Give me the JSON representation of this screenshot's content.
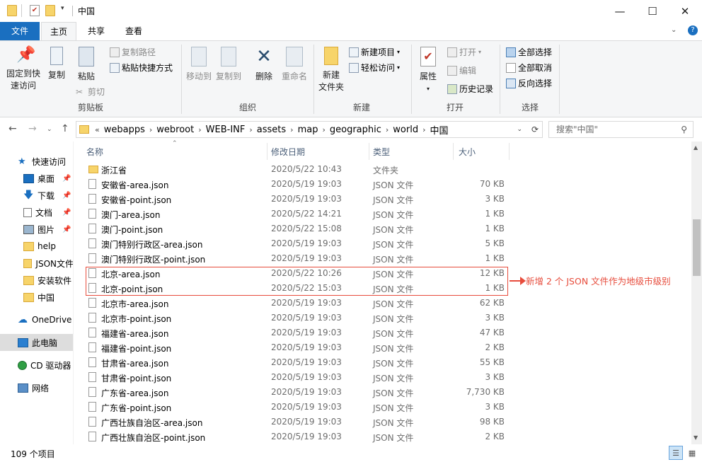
{
  "window": {
    "title": "中国"
  },
  "ribbon_tabs": {
    "file": "文件",
    "home": "主页",
    "share": "共享",
    "view": "查看"
  },
  "ribbon": {
    "clipboard": {
      "pin_label_1": "固定到快",
      "pin_label_2": "速访问",
      "copy": "复制",
      "paste": "粘贴",
      "copy_path": "复制路径",
      "paste_shortcut": "粘贴快捷方式",
      "cut": "剪切",
      "group": "剪贴板"
    },
    "organize": {
      "move_to": "移动到",
      "copy_to": "复制到",
      "delete": "删除",
      "rename": "重命名",
      "group": "组织"
    },
    "new": {
      "new_folder_1": "新建",
      "new_folder_2": "文件夹",
      "new_item": "新建项目",
      "easy_access": "轻松访问",
      "group": "新建"
    },
    "open": {
      "properties": "属性",
      "open": "打开",
      "edit": "编辑",
      "history": "历史记录",
      "group": "打开"
    },
    "select": {
      "select_all": "全部选择",
      "select_none": "全部取消",
      "invert": "反向选择",
      "group": "选择"
    }
  },
  "address": {
    "overflow": "«",
    "crumbs": [
      "webapps",
      "webroot",
      "WEB-INF",
      "assets",
      "map",
      "geographic",
      "world",
      "中国"
    ],
    "search_placeholder": "搜索\"中国\""
  },
  "nav_pane": {
    "items": [
      {
        "label": "快速访问",
        "icon": "star-icon"
      },
      {
        "label": "桌面",
        "icon": "desktop-icon",
        "pinned": true
      },
      {
        "label": "下载",
        "icon": "download-icon",
        "pinned": true
      },
      {
        "label": "文档",
        "icon": "document-icon",
        "pinned": true
      },
      {
        "label": "图片",
        "icon": "picture-icon",
        "pinned": true
      },
      {
        "label": "help",
        "icon": "folder-icon"
      },
      {
        "label": "JSON文件",
        "icon": "folder-icon"
      },
      {
        "label": "安装软件",
        "icon": "folder-icon"
      },
      {
        "label": "中国",
        "icon": "folder-icon"
      },
      {
        "label": "OneDrive",
        "icon": "cloud-icon"
      },
      {
        "label": "此电脑",
        "icon": "computer-icon",
        "selected": true
      },
      {
        "label": "CD 驱动器",
        "icon": "cd-icon"
      },
      {
        "label": "网络",
        "icon": "network-icon"
      }
    ]
  },
  "columns": {
    "name": "名称",
    "date": "修改日期",
    "type": "类型",
    "size": "大小"
  },
  "files": [
    {
      "name": "浙江省",
      "date": "2020/5/22 10:43",
      "type": "文件夹",
      "size": "",
      "folder": true
    },
    {
      "name": "安徽省-area.json",
      "date": "2020/5/19 19:03",
      "type": "JSON 文件",
      "size": "70 KB"
    },
    {
      "name": "安徽省-point.json",
      "date": "2020/5/19 19:03",
      "type": "JSON 文件",
      "size": "3 KB"
    },
    {
      "name": "澳门-area.json",
      "date": "2020/5/22 14:21",
      "type": "JSON 文件",
      "size": "1 KB"
    },
    {
      "name": "澳门-point.json",
      "date": "2020/5/22 15:08",
      "type": "JSON 文件",
      "size": "1 KB"
    },
    {
      "name": "澳门特别行政区-area.json",
      "date": "2020/5/19 19:03",
      "type": "JSON 文件",
      "size": "5 KB"
    },
    {
      "name": "澳门特别行政区-point.json",
      "date": "2020/5/19 19:03",
      "type": "JSON 文件",
      "size": "1 KB"
    },
    {
      "name": "北京-area.json",
      "date": "2020/5/22 10:26",
      "type": "JSON 文件",
      "size": "12 KB"
    },
    {
      "name": "北京-point.json",
      "date": "2020/5/22 15:03",
      "type": "JSON 文件",
      "size": "1 KB"
    },
    {
      "name": "北京市-area.json",
      "date": "2020/5/19 19:03",
      "type": "JSON 文件",
      "size": "62 KB"
    },
    {
      "name": "北京市-point.json",
      "date": "2020/5/19 19:03",
      "type": "JSON 文件",
      "size": "3 KB"
    },
    {
      "name": "福建省-area.json",
      "date": "2020/5/19 19:03",
      "type": "JSON 文件",
      "size": "47 KB"
    },
    {
      "name": "福建省-point.json",
      "date": "2020/5/19 19:03",
      "type": "JSON 文件",
      "size": "2 KB"
    },
    {
      "name": "甘肃省-area.json",
      "date": "2020/5/19 19:03",
      "type": "JSON 文件",
      "size": "55 KB"
    },
    {
      "name": "甘肃省-point.json",
      "date": "2020/5/19 19:03",
      "type": "JSON 文件",
      "size": "3 KB"
    },
    {
      "name": "广东省-area.json",
      "date": "2020/5/19 19:03",
      "type": "JSON 文件",
      "size": "7,730 KB"
    },
    {
      "name": "广东省-point.json",
      "date": "2020/5/19 19:03",
      "type": "JSON 文件",
      "size": "3 KB"
    },
    {
      "name": "广西壮族自治区-area.json",
      "date": "2020/5/19 19:03",
      "type": "JSON 文件",
      "size": "98 KB"
    },
    {
      "name": "广西壮族自治区-point.json",
      "date": "2020/5/19 19:03",
      "type": "JSON 文件",
      "size": "2 KB"
    }
  ],
  "annotation": {
    "text": "新增 2 个 JSON 文件作为地级市级别",
    "color": "#e74c3c"
  },
  "status": {
    "item_count": "109 个项目"
  },
  "colors": {
    "file_tab": "#1a6fc0",
    "ribbon_bg": "#f5f6f7",
    "header_text": "#4c607a"
  }
}
